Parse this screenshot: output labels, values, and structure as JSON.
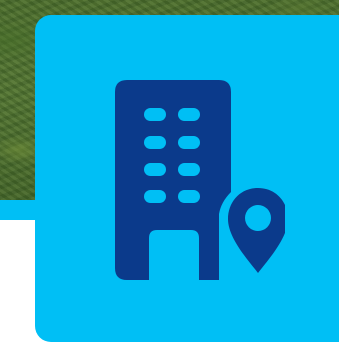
{
  "scene": {
    "background_image": "aerial-landscape-photo",
    "tile_color": "#00bff5",
    "icon_color": "#0b3a8b",
    "icon": "building-location-icon"
  }
}
